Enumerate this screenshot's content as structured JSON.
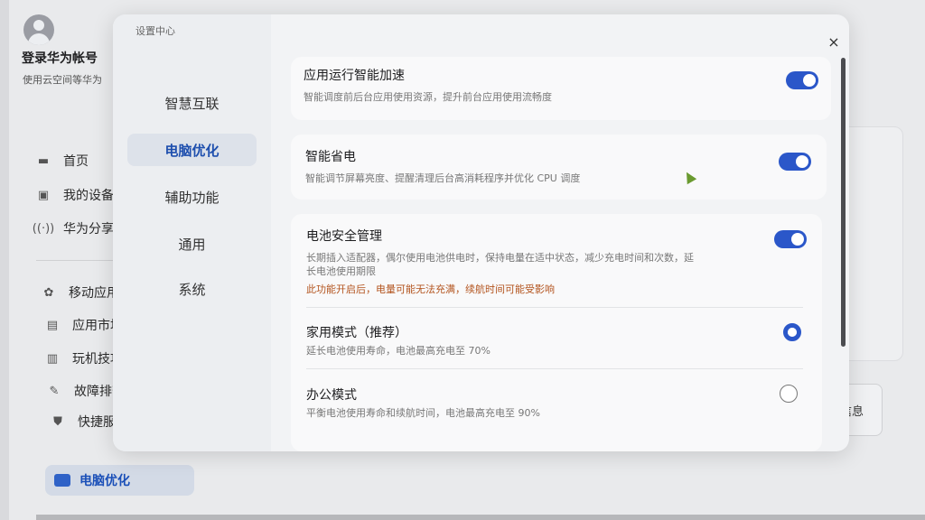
{
  "background_app": {
    "login_title": "登录华为帐号",
    "login_subtitle": "使用云空间等华为",
    "nav_items": [
      {
        "label": "首页",
        "icon": "monitor-icon"
      },
      {
        "label": "我的设备",
        "icon": "devices-icon"
      },
      {
        "label": "华为分享",
        "icon": "share-icon"
      },
      {
        "label": "移动应用",
        "icon": "apps-icon"
      },
      {
        "label": "应用市场",
        "icon": "store-icon"
      },
      {
        "label": "玩机技巧",
        "icon": "tips-icon"
      },
      {
        "label": "故障排查",
        "icon": "wrench-icon"
      },
      {
        "label": "快捷服务",
        "icon": "shield-icon"
      }
    ],
    "bottom_nav_label": "电脑优化",
    "info_button_label": "件信息"
  },
  "dialog": {
    "title": "设置中心",
    "close_glyph": "×",
    "side_items": [
      {
        "label": "智慧互联",
        "active": false
      },
      {
        "label": "电脑优化",
        "active": true
      },
      {
        "label": "辅助功能",
        "active": false
      },
      {
        "label": "通用",
        "active": false
      },
      {
        "label": "系统",
        "active": false
      }
    ],
    "settings": {
      "app_accel": {
        "title": "应用运行智能加速",
        "desc": "智能调度前后台应用使用资源，提升前台应用使用流畅度",
        "enabled": true
      },
      "power_save": {
        "title": "智能省电",
        "desc": "智能调节屏幕亮度、提醒清理后台高消耗程序并优化 CPU 调度",
        "enabled": true
      },
      "battery": {
        "title": "电池安全管理",
        "desc_line1": "长期插入适配器，偶尔使用电池供电时，保持电量在适中状态，减少充电时间和次数，延",
        "desc_line2": "长电池使用期限",
        "warning": "此功能开启后，电量可能无法充满，续航时间可能受影响",
        "enabled": true,
        "modes": [
          {
            "title": "家用模式（推荐）",
            "desc": "延长电池使用寿命，电池最高充电至 70%",
            "selected": true
          },
          {
            "title": "办公模式",
            "desc": "平衡电池使用寿命和续航时间，电池最高充电至 90%",
            "selected": false
          }
        ]
      }
    }
  },
  "colors": {
    "accent": "#2b57c9",
    "warning": "#b3541e"
  }
}
